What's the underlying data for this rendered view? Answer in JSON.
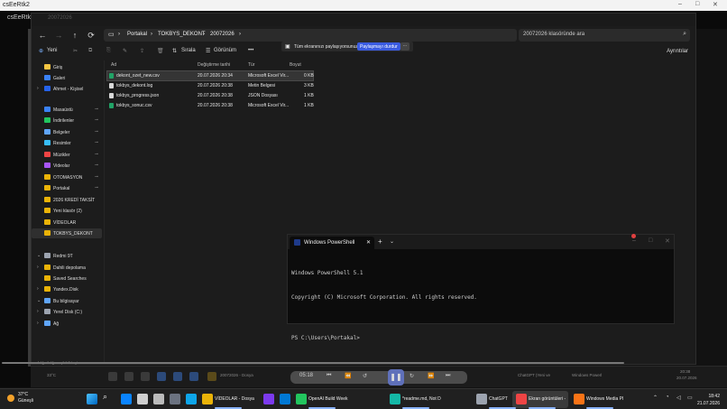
{
  "host": {
    "title": "csEeRtk2",
    "controls": [
      "–",
      "□",
      "✕"
    ]
  },
  "explorer": {
    "tab_title": "20072026",
    "nav": {
      "back": "←",
      "forward": "→",
      "up": "↑",
      "refresh": "⟳"
    },
    "breadcrumb": [
      "Portakal",
      "TOKBYS_DEKONT",
      "20072026"
    ],
    "search_placeholder": "20072026 klasöründe ara",
    "toolbar": {
      "new": "Yeni",
      "sort": "Sırala",
      "view": "Görünüm",
      "more": "•••",
      "details": "Ayrıntılar"
    },
    "share_banner": {
      "message": "Tüm ekranınızı paylaşıyorsunuz.",
      "stop": "Paylaşmayı durdur",
      "more": "..."
    },
    "sidebar": [
      {
        "label": "Giriş",
        "color": "#f5c542",
        "chev": "",
        "pin": false
      },
      {
        "label": "Galeri",
        "color": "#3b82f6",
        "chev": "",
        "pin": false
      },
      {
        "label": "Ahmet - Kişisel",
        "color": "#2563eb",
        "chev": "›",
        "pin": false
      },
      {
        "label": "Masaüstü",
        "color": "#3b82f6",
        "chev": "",
        "pin": true
      },
      {
        "label": "İndirilenler",
        "color": "#22c55e",
        "chev": "",
        "pin": true
      },
      {
        "label": "Belgeler",
        "color": "#60a5fa",
        "chev": "",
        "pin": true
      },
      {
        "label": "Resimler",
        "color": "#38bdf8",
        "chev": "",
        "pin": true
      },
      {
        "label": "Müzikler",
        "color": "#ef4444",
        "chev": "",
        "pin": true
      },
      {
        "label": "Videolar",
        "color": "#a855f7",
        "chev": "",
        "pin": true
      },
      {
        "label": "OTOMASYON",
        "color": "#eab308",
        "chev": "",
        "pin": true
      },
      {
        "label": "Portakal",
        "color": "#eab308",
        "chev": "",
        "pin": true
      },
      {
        "label": "2026 KREDİ TAKSİT",
        "color": "#eab308",
        "chev": "",
        "pin": false
      },
      {
        "label": "Yeni klasör (2)",
        "color": "#eab308",
        "chev": "",
        "pin": false
      },
      {
        "label": "VİDEOLAR",
        "color": "#eab308",
        "chev": "",
        "pin": false
      },
      {
        "label": "TOKBYS_DEKONT",
        "color": "#eab308",
        "chev": "",
        "pin": false,
        "selected": true
      },
      {
        "label": "Redmi 9T",
        "color": "#9ca3af",
        "chev": "⌄",
        "pin": false
      },
      {
        "label": "Dahili depolama",
        "color": "#eab308",
        "chev": "›",
        "pin": false
      },
      {
        "label": "Saved Searches",
        "color": "#eab308",
        "chev": "",
        "pin": false
      },
      {
        "label": "Yandex.Disk",
        "color": "#eab308",
        "chev": "›",
        "pin": false
      },
      {
        "label": "Bu bilgisayar",
        "color": "#60a5fa",
        "chev": "⌄",
        "pin": false
      },
      {
        "label": "Yerel Disk (C:)",
        "color": "#9ca3af",
        "chev": "›",
        "pin": false
      },
      {
        "label": "Ağ",
        "color": "#60a5fa",
        "chev": "›",
        "pin": false
      }
    ],
    "columns": [
      "Ad",
      "Değiştirme tarihi",
      "Tür",
      "Boyut"
    ],
    "files": [
      {
        "name": "dekont_ozet_new.csv",
        "date": "20.07.2026 20:34",
        "type": "Microsoft Excel Vir...",
        "size": "0 KB",
        "selected": true
      },
      {
        "name": "tokbys_dekont.log",
        "date": "20.07.2026 20:38",
        "type": "Metin Belgesi",
        "size": "3 KB"
      },
      {
        "name": "tokbys_progress.json",
        "date": "20.07.2026 20:38",
        "type": "JSON Dosyası",
        "size": "1 KB"
      },
      {
        "name": "tokbys_sonuc.csv",
        "date": "20.07.2026 20:38",
        "type": "Microsoft Excel Vir...",
        "size": "1 KB"
      }
    ],
    "status": "4 öğe   1 öğe seçildi  0 bayt"
  },
  "powershell": {
    "tab_label": "Windows PowerShell",
    "close": "✕",
    "add": "+",
    "dropdown": "⌄",
    "lines": [
      "Windows PowerShell 5.1",
      "Copyright (C) Microsoft Corporation. All rights reserved.",
      "",
      "PS C:\\Users\\Portakal>"
    ]
  },
  "inner_taskbar": {
    "left_text": "33°C",
    "items": [
      "20072026 - Dosya",
      "VİDEOLAR - Dosya",
      "ChatGPT (Yeni ve",
      "Windows Powerl"
    ],
    "time": "20:38",
    "date": "20.07.2026",
    "media_time": "05:18"
  },
  "taskbar": {
    "weather_temp": "37°C",
    "weather_cond": "Güneşli",
    "apps": [
      {
        "label": "",
        "color": "#0a84ff"
      },
      {
        "label": "",
        "color": "#cfcfcf"
      },
      {
        "label": "",
        "color": "#bbbbbb"
      },
      {
        "label": "",
        "color": "#6b7280"
      },
      {
        "label": "",
        "color": "#0ea5e9"
      },
      {
        "label": "",
        "color": "#7c3aed"
      },
      {
        "label": "",
        "color": "#0078d4"
      }
    ],
    "labeled_apps": [
      {
        "label": "VİDEOLAR - Dosya",
        "color": "#eab308"
      },
      {
        "label": "OpenAI Build Week",
        "color": "#22c55e"
      },
      {
        "label": "*readme.md, Not D",
        "color": "#14b8a6"
      },
      {
        "label": "ChatGPT",
        "color": "#9ca3af"
      },
      {
        "label": "Ekran görüntüleri -",
        "color": "#ef4444"
      },
      {
        "label": "Windows Media Pl",
        "color": "#f97316"
      }
    ],
    "time": "18:42",
    "date": "21.07.2026"
  }
}
